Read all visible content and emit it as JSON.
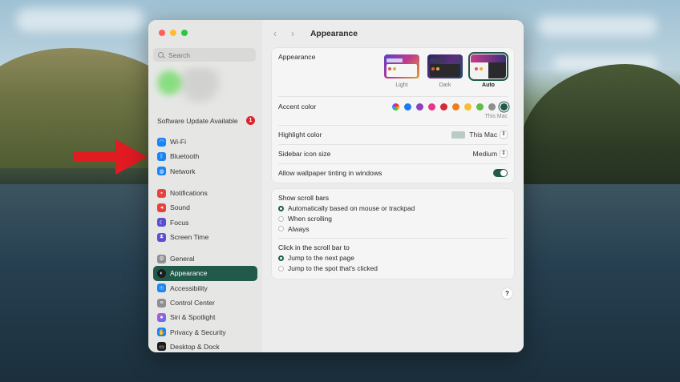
{
  "search": {
    "placeholder": "Search"
  },
  "sidebar": {
    "update_label": "Software Update Available",
    "update_badge": "1",
    "network_items": [
      {
        "label": "Wi-Fi",
        "color": "#1a84f5",
        "icon": "wifi-icon"
      },
      {
        "label": "Bluetooth",
        "color": "#1a84f5",
        "icon": "bluetooth-icon"
      },
      {
        "label": "Network",
        "color": "#1a84f5",
        "icon": "globe-icon"
      }
    ],
    "focus_items": [
      {
        "label": "Notifications",
        "color": "#e9413c",
        "icon": "bell-icon"
      },
      {
        "label": "Sound",
        "color": "#e9413c",
        "icon": "speaker-icon"
      },
      {
        "label": "Focus",
        "color": "#5b4ed1",
        "icon": "moon-icon"
      },
      {
        "label": "Screen Time",
        "color": "#5b4ed1",
        "icon": "hourglass-icon"
      }
    ],
    "system_items": [
      {
        "label": "General",
        "color": "#8e8e93",
        "icon": "gear-icon"
      },
      {
        "label": "Appearance",
        "color": "#1c1c1e",
        "icon": "appearance-icon",
        "selected": true
      },
      {
        "label": "Accessibility",
        "color": "#1a84f5",
        "icon": "accessibility-icon"
      },
      {
        "label": "Control Center",
        "color": "#8e8e93",
        "icon": "control-center-icon"
      },
      {
        "label": "Siri & Spotlight",
        "color": "#b04fd6",
        "icon": "siri-icon"
      },
      {
        "label": "Privacy & Security",
        "color": "#1a84f5",
        "icon": "hand-icon"
      },
      {
        "label": "Desktop & Dock",
        "color": "#1c1c1e",
        "icon": "dock-icon"
      }
    ]
  },
  "header": {
    "title": "Appearance"
  },
  "appearance": {
    "label": "Appearance",
    "options": [
      {
        "label": "Light"
      },
      {
        "label": "Dark"
      },
      {
        "label": "Auto",
        "selected": true
      }
    ],
    "accent_label": "Accent color",
    "accent_colors": [
      "multicolor",
      "#1a7cf5",
      "#8e3fbf",
      "#e6358a",
      "#d52a37",
      "#ee7d1e",
      "#f4c02b",
      "#5fbd48",
      "#8e8e8e",
      "#215a4b"
    ],
    "accent_selected_index": 9,
    "accent_caption": "This Mac",
    "highlight_label": "Highlight color",
    "highlight_value": "This Mac",
    "sidebar_size_label": "Sidebar icon size",
    "sidebar_size_value": "Medium",
    "tinting_label": "Allow wallpaper tinting in windows",
    "tinting_on": true
  },
  "scroll": {
    "show_label": "Show scroll bars",
    "show_options": [
      {
        "label": "Automatically based on mouse or trackpad",
        "selected": true
      },
      {
        "label": "When scrolling"
      },
      {
        "label": "Always"
      }
    ],
    "click_label": "Click in the scroll bar to",
    "click_options": [
      {
        "label": "Jump to the next page",
        "selected": true
      },
      {
        "label": "Jump to the spot that's clicked"
      }
    ]
  },
  "help_label": "?"
}
